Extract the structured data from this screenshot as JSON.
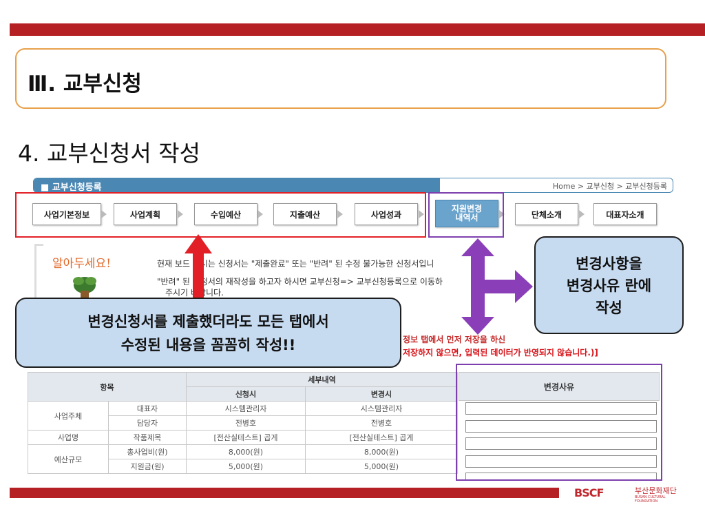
{
  "slide": {
    "section_title": "Ⅲ. 교부신청",
    "subtitle": "4. 교부신청서 작성"
  },
  "registration": {
    "title": "■ 교부신청등록",
    "breadcrumb": "Home > 교부신청 > 교부신청등록"
  },
  "tabs": [
    {
      "label": "사업기본정보"
    },
    {
      "label": "사업계획"
    },
    {
      "label": "수입예산"
    },
    {
      "label": "지출예산"
    },
    {
      "label": "사업성과"
    },
    {
      "label": "지원변경\n내역서",
      "active": true
    },
    {
      "label": "단체소개"
    },
    {
      "label": "대표자소개"
    }
  ],
  "notice": {
    "title": "알아두세요!",
    "line1": "현재 보드 게시는 신청서는 \"제출완료\" 또는 \"반려\" 된 수정 불가능한 신청서입니",
    "line2": "\"반려\" 된 신청서의 재작성을 하고자 하시면 교부신청=> 교부신청등록으로 이동하",
    "line3": "주시기 바랍니다.",
    "warn1": "정보 탭에서 먼저 저장을 하신",
    "warn2": "저장하지 않으면, 입력된 데이터가 반영되지 않습니다.)]"
  },
  "callouts": {
    "left_line1": "변경신청서를 제출했더라도 모든 탭에서",
    "left_line2": "수정된 내용을 꼼꼼히 작성!!",
    "right_line1": "변경사항을",
    "right_line2": "변경사유 란에",
    "right_line3": "작성"
  },
  "table": {
    "headers": {
      "item": "항목",
      "detail": "세부내역",
      "apply": "신청시",
      "change": "변경시",
      "reason": "변경사유"
    },
    "rows": [
      {
        "group": "사업주체",
        "sub": "대표자",
        "apply": "시스템관리자",
        "change": "시스템관리자"
      },
      {
        "group": "",
        "sub": "담당자",
        "apply": "전병호",
        "change": "전병호"
      },
      {
        "group": "사업명",
        "sub": "작품제목",
        "apply": "[전산실테스트] 곱게",
        "change": "[전산실테스트] 곱게"
      },
      {
        "group": "예산규모",
        "sub": "총사업비(원)",
        "apply": "8,000(원)",
        "change": "8,000(원)"
      },
      {
        "group": "",
        "sub": "지원금(원)",
        "apply": "5,000(원)",
        "change": "5,000(원)"
      }
    ]
  },
  "logo": {
    "mark": "BSCF",
    "name": "부산문화재단",
    "sub": "BUSAN CULTURAL FOUNDATION"
  },
  "colors": {
    "bar": "#b52025",
    "accent_blue": "#4a87b3",
    "red_highlight": "#e21f26",
    "purple_highlight": "#7d3fae",
    "callout_fill": "#c6daf0"
  }
}
